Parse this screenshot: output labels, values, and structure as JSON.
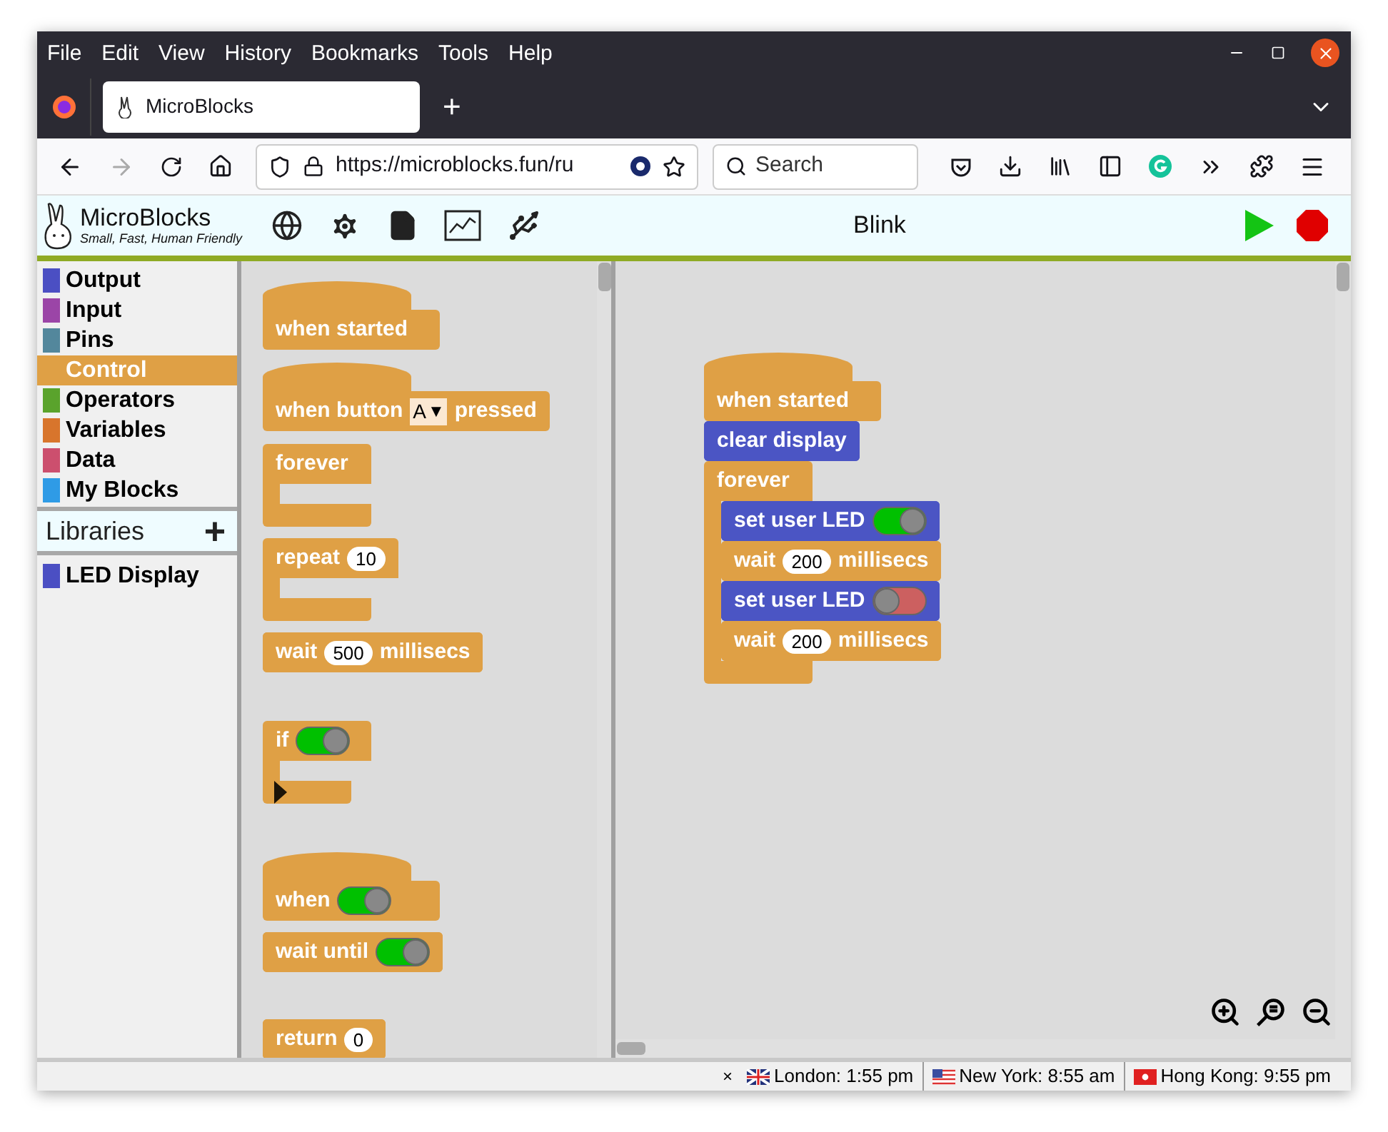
{
  "menu_bar": [
    "File",
    "Edit",
    "View",
    "History",
    "Bookmarks",
    "Tools",
    "Help"
  ],
  "tab": {
    "title": "MicroBlocks",
    "new_tab": "+"
  },
  "nav": {
    "url": "https://microblocks.fun/ru",
    "search": {
      "placeholder": "Search"
    }
  },
  "app_toolbar": {
    "logo": "MicroBlocks",
    "tagline": "Small, Fast, Human Friendly",
    "project_title": "Blink"
  },
  "categories": [
    {
      "label": "Output",
      "color": "#4b4fc3",
      "selected": false
    },
    {
      "label": "Input",
      "color": "#9b45a7",
      "selected": false
    },
    {
      "label": "Pins",
      "color": "#53879c",
      "selected": false
    },
    {
      "label": "Control",
      "color": "#dfa045",
      "selected": true
    },
    {
      "label": "Operators",
      "color": "#5aa32c",
      "selected": false
    },
    {
      "label": "Variables",
      "color": "#d8752c",
      "selected": false
    },
    {
      "label": "Data",
      "color": "#cc4f6e",
      "selected": false
    },
    {
      "label": "My Blocks",
      "color": "#2f9be6",
      "selected": false
    }
  ],
  "libraries_header": {
    "label": "Libraries",
    "add": "+"
  },
  "libraries": [
    {
      "label": "LED Display",
      "color": "#4b4fc3"
    }
  ],
  "palette": [
    {
      "kind": "hat",
      "color": "#dfa045",
      "parts": [
        {
          "kind": "text",
          "text": "when started"
        }
      ]
    },
    {
      "kind": "hat",
      "color": "#dfa045",
      "parts": [
        {
          "kind": "text",
          "text": "when button"
        },
        {
          "kind": "dropdown",
          "value": "A",
          "arrow": "▼"
        },
        {
          "kind": "text",
          "text": "pressed"
        }
      ]
    },
    {
      "kind": "c",
      "color": "#dfa045",
      "parts": [
        {
          "kind": "text",
          "text": "forever"
        }
      ]
    },
    {
      "kind": "c",
      "color": "#dfa045",
      "parts": [
        {
          "kind": "text",
          "text": "repeat"
        },
        {
          "kind": "number",
          "value": "10"
        }
      ]
    },
    {
      "kind": "command",
      "color": "#dfa045",
      "parts": [
        {
          "kind": "text",
          "text": "wait"
        },
        {
          "kind": "number",
          "value": "500"
        },
        {
          "kind": "text",
          "text": "millisecs"
        }
      ]
    },
    {
      "kind": "if",
      "color": "#dfa045",
      "parts": [
        {
          "kind": "text",
          "text": "if"
        },
        {
          "kind": "toggle",
          "on": true
        }
      ]
    },
    {
      "kind": "hat",
      "color": "#dfa045",
      "parts": [
        {
          "kind": "text",
          "text": "when"
        },
        {
          "kind": "toggle",
          "on": true
        }
      ]
    },
    {
      "kind": "command",
      "color": "#dfa045",
      "parts": [
        {
          "kind": "text",
          "text": "wait until"
        },
        {
          "kind": "toggle",
          "on": true
        }
      ]
    },
    {
      "kind": "command",
      "color": "#dfa045",
      "parts": [
        {
          "kind": "text",
          "text": "return"
        },
        {
          "kind": "number",
          "value": "0"
        }
      ]
    }
  ],
  "script": [
    {
      "kind": "hat",
      "color": "#dfa045",
      "parts": [
        {
          "kind": "text",
          "text": "when started"
        }
      ]
    },
    {
      "kind": "command",
      "color": "#4b55c4",
      "parts": [
        {
          "kind": "text",
          "text": "clear display"
        }
      ]
    },
    {
      "kind": "c",
      "color": "#dfa045",
      "parts": [
        {
          "kind": "text",
          "text": "forever"
        }
      ],
      "children": [
        {
          "kind": "command",
          "color": "#4b55c4",
          "parts": [
            {
              "kind": "text",
              "text": "set user LED"
            },
            {
              "kind": "toggle",
              "on": true
            }
          ]
        },
        {
          "kind": "command",
          "color": "#dfa045",
          "parts": [
            {
              "kind": "text",
              "text": "wait"
            },
            {
              "kind": "number",
              "value": "200"
            },
            {
              "kind": "text",
              "text": "millisecs"
            }
          ]
        },
        {
          "kind": "command",
          "color": "#4b55c4",
          "parts": [
            {
              "kind": "text",
              "text": "set user LED"
            },
            {
              "kind": "toggle",
              "on": false
            }
          ]
        },
        {
          "kind": "command",
          "color": "#dfa045",
          "parts": [
            {
              "kind": "text",
              "text": "wait"
            },
            {
              "kind": "number",
              "value": "200"
            },
            {
              "kind": "text",
              "text": "millisecs"
            }
          ]
        }
      ]
    }
  ],
  "status_bar": {
    "close": "×",
    "clocks": [
      {
        "kind": "uk",
        "text": "London: 1:55 pm"
      },
      {
        "kind": "us",
        "text": "New York: 8:55 am"
      },
      {
        "kind": "hk",
        "text": "Hong Kong: 9:55 pm"
      }
    ]
  }
}
